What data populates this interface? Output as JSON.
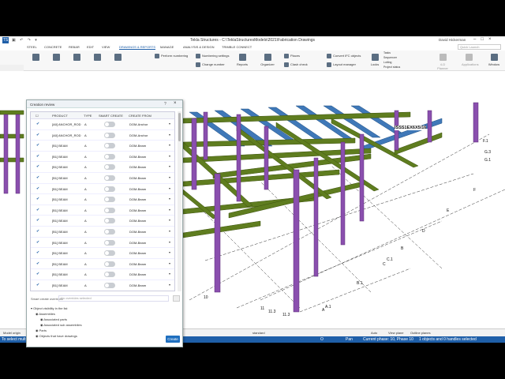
{
  "app": {
    "title": "Tekla Structures - C:\\TeklaStructuresModels\\2021\\Fabrication Drawings",
    "user": "David Hickerman",
    "search_placeholder": "Quick Launch",
    "logo": "TS"
  },
  "menu": {
    "tabs": [
      "STEEL",
      "CONCRETE",
      "REBAR",
      "EDIT",
      "VIEW",
      "DRAWINGS & REPORTS",
      "MANAGE",
      "ANALYSIS & DESIGN",
      "TRIMBLE CONNECT"
    ],
    "active": "DRAWINGS & REPORTS"
  },
  "ribbon": {
    "numbering_settings": "Numbering settings",
    "perform_numbering": "Perform numbering",
    "change_number": "Change number",
    "reports": "Reports",
    "organizer": "Organizer",
    "places": "Places",
    "clash_check": "Clash check",
    "convert_ifc": "Convert IFC objects",
    "layout_manager": "Layout manager",
    "locks": "Locks",
    "tasks": "Tasks",
    "sequencer": "Sequencer",
    "lotting": "Lotting",
    "project_status": "Project status",
    "assembly": "4-D Planner",
    "window": "Window",
    "applications": "Applications"
  },
  "dialog": {
    "title": "Creation review",
    "columns": [
      "PRODUCT",
      "TYPE",
      "SMART CREATE",
      "CREATE FROM"
    ],
    "rows": [
      {
        "product": "[A0] ANCHOR_ROD",
        "type": "A",
        "from": "DOM-Anchor"
      },
      {
        "product": "[A0] ANCHOR_ROD",
        "type": "A",
        "from": "DOM-Anchor"
      },
      {
        "product": "[B1] BEAM",
        "type": "A",
        "from": "DOM-Beam"
      },
      {
        "product": "[B1] BEAM",
        "type": "A",
        "from": "DOM-Beam"
      },
      {
        "product": "[B1] BEAM",
        "type": "A",
        "from": "DOM-Beam"
      },
      {
        "product": "[B1] BEAM",
        "type": "A",
        "from": "DOM-Beam"
      },
      {
        "product": "[B1] BEAM",
        "type": "A",
        "from": "DOM-Beam"
      },
      {
        "product": "[B1] BEAM",
        "type": "A",
        "from": "DOM-Beam"
      },
      {
        "product": "[B1] BEAM",
        "type": "A",
        "from": "DOM-Beam"
      },
      {
        "product": "[B1] BEAM",
        "type": "A",
        "from": "DOM-Beam"
      },
      {
        "product": "[B1] BEAM",
        "type": "A",
        "from": "DOM-Beam"
      },
      {
        "product": "[B1] BEAM",
        "type": "A",
        "from": "DOM-Beam"
      },
      {
        "product": "[B1] BEAM",
        "type": "A",
        "from": "DOM-Beam"
      },
      {
        "product": "[B1] BEAM",
        "type": "A",
        "from": "DOM-Beam"
      },
      {
        "product": "[B1] BEAM",
        "type": "A",
        "from": "DOM-Beam"
      },
      {
        "product": "[B1] BEAM",
        "type": "A",
        "from": "DOM-Beam"
      }
    ],
    "smart_create_label": "Smart create overrides",
    "smart_create_value": "No overrides selected",
    "visibility_header": "Object visibility in the list",
    "visibility_items": [
      "Assemblies",
      "Associated parts",
      "Associated sub assemblies",
      "Parts",
      "Objects that have drawings"
    ],
    "create_label": "Create"
  },
  "viewport": {
    "labels": [
      "ISSS1EX6X5/16",
      "F.1",
      "G.3",
      "G.1",
      "E",
      "F",
      "D",
      "C.1",
      "C",
      "B",
      "B.1",
      "A",
      "A.1",
      "10",
      "11.3",
      "11.3",
      "11"
    ]
  },
  "bottombar": {
    "model_origin": "Model origin",
    "search_placeholder": "Search in model",
    "standard": "standard",
    "auto": "Auto",
    "view_plane": "View plane",
    "outline_planes": "Outline planes"
  },
  "status": {
    "hint": "To select multiple objects, hold down CTRL or SHIFT while selecting",
    "o": "O",
    "pan": "Pan",
    "phase": "Current phase: 10, Phase 10",
    "selected": "1 objects and 0 handles selected"
  },
  "colors": {
    "beam_green": "#5f7d1f",
    "column_purple": "#8a4fae",
    "joist_blue": "#3f78b8",
    "status_blue": "#1f5fa8"
  }
}
